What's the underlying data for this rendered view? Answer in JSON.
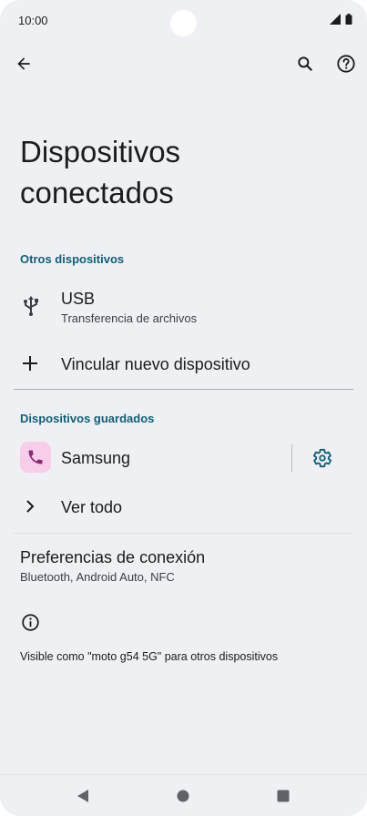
{
  "status_bar": {
    "time": "10:00"
  },
  "header": {
    "title": "Dispositivos conectados"
  },
  "sections": {
    "other_devices": {
      "label": "Otros dispositivos",
      "usb": {
        "title": "USB",
        "subtitle": "Transferencia de archivos"
      },
      "pair_new": {
        "label": "Vincular nuevo dispositivo"
      }
    },
    "saved_devices": {
      "label": "Dispositivos guardados",
      "device": {
        "name": "Samsung"
      },
      "see_all": {
        "label": "Ver todo"
      }
    }
  },
  "preferences": {
    "title": "Preferencias de conexión",
    "subtitle": "Bluetooth, Android Auto, NFC"
  },
  "footer": {
    "visibility_text": "Visible como \"moto g54 5G\" para otros dispositivos"
  },
  "icons": {
    "back": "arrow-left-icon",
    "search": "search-icon",
    "help": "help-icon",
    "usb": "usb-icon",
    "add": "plus-icon",
    "phone": "phone-icon",
    "settings": "gear-icon",
    "chevron": "chevron-right-icon",
    "info": "info-icon"
  },
  "colors": {
    "accent": "#0e5f7a",
    "background": "#eff0f3",
    "device_icon_bg": "#f8cde9",
    "device_icon_fg": "#8c2a74"
  }
}
